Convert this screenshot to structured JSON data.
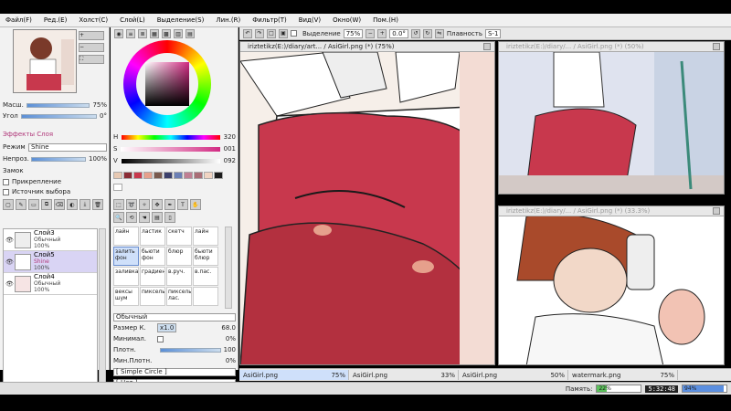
{
  "menu": [
    "Файл(F)",
    "Ред.(E)",
    "Холст(C)",
    "Слой(L)",
    "Выделение(S)",
    "Лин.(R)",
    "Фильтр(T)",
    "Вид(V)",
    "Окно(W)",
    "Пом.(H)"
  ],
  "toolbar": {
    "selection_label": "Выделение",
    "zoom_value": "75%",
    "rotation_value": "0.0°",
    "stabilizer_label": "Плавность",
    "stabilizer_value": "S-1"
  },
  "navigator": {
    "zoom_label": "Масш.",
    "zoom_value": "75%",
    "angle_label": "Угол",
    "angle_value": "0°"
  },
  "layer_props": {
    "effects_label": "Эффекты Слоя",
    "mode_label": "Режим",
    "mode_value": "Shine",
    "opacity_label": "Непроз.",
    "opacity_value": "100%",
    "lock_label": "Замок",
    "clipping_label": "Прикрепление",
    "selection_source_label": "Источник выбора"
  },
  "layers": [
    {
      "name": "Слой3",
      "mode": "Обычный",
      "opacity": "100%",
      "selected": false
    },
    {
      "name": "Слой5",
      "mode": "Shine",
      "opacity": "100%",
      "selected": true
    },
    {
      "name": "Слой4",
      "mode": "Обычный",
      "opacity": "100%",
      "selected": false
    }
  ],
  "color": {
    "h_label": "H",
    "h_value": "320",
    "s_label": "S",
    "s_value": "001",
    "v_label": "V",
    "v_value": "092",
    "swatches": [
      "#e7c9b3",
      "#8b2c35",
      "#c8384d",
      "#e6a08c",
      "#7a5a4e",
      "#3b3f6b",
      "#6b7fb5",
      "#c07f93",
      "#a96d76",
      "#f0d4c2",
      "#1b1b1b",
      "#ffffff"
    ]
  },
  "brushes": [
    {
      "label": "лайн"
    },
    {
      "label": "ластик"
    },
    {
      "label": "скетч"
    },
    {
      "label": "лайн"
    },
    {
      "label": "залить фон",
      "active": true
    },
    {
      "label": "бьюти фон"
    },
    {
      "label": "блюр"
    },
    {
      "label": "бьюти блюр"
    },
    {
      "label": "заливка"
    },
    {
      "label": "градиент"
    },
    {
      "label": "в.руч."
    },
    {
      "label": "в.пас."
    },
    {
      "label": "вексы шум"
    },
    {
      "label": "пиксель"
    },
    {
      "label": "пиксель лас."
    },
    {
      "label": ""
    }
  ],
  "brush_props": {
    "mode_value": "Обычный",
    "size_label": "Размер К.",
    "size_multiplier": "x1.0",
    "size_value": "68.0",
    "min_label": "Минимал.",
    "min_value": "0%",
    "density_label": "Плотн.",
    "density_value": "100",
    "min_density_label": "Мин.Плотн.",
    "min_density_value": "0%",
    "shape_value": "[ Simple Circle ]",
    "texture_value": "[ Нет ]"
  },
  "windows": {
    "main_title": "iriztetikz(E:)/diary/art... / AsiGirl.png (*) (75%)",
    "sub1_title": "iriztetikz(E:)/diary/... / AsiGirl.png (*) (50%)",
    "sub2_title": "iriztetikz(E:)/diary/... / AsiGirl.png (*) (33.3%)"
  },
  "tasks": [
    {
      "name": "AsiGirl.png",
      "pct": "75%",
      "active": true
    },
    {
      "name": "AsiGirl.png",
      "pct": "33%",
      "active": false
    },
    {
      "name": "AsiGirl.png",
      "pct": "50%",
      "active": false
    },
    {
      "name": "watermark.png",
      "pct": "75%",
      "active": false
    }
  ],
  "status": {
    "memory_label": "Память:",
    "memory_value": "22%",
    "memory_fraction": 0.22,
    "time": "5:32:48",
    "disk_value": "94%",
    "disk_fraction": 0.94
  }
}
